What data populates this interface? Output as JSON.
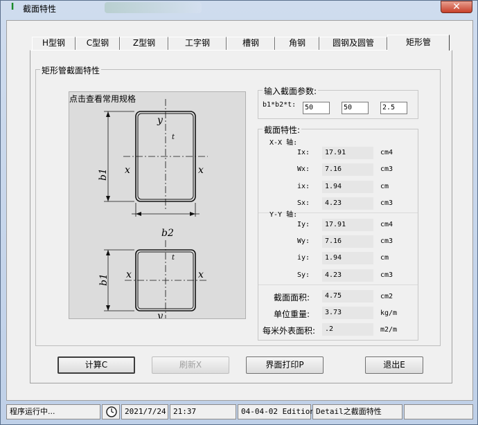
{
  "window": {
    "title": "截面特性",
    "close_glyph": "✕"
  },
  "tabs": [
    {
      "label": "H型钢"
    },
    {
      "label": "C型钢"
    },
    {
      "label": "Z型钢"
    },
    {
      "label": "工字钢"
    },
    {
      "label": "槽钢"
    },
    {
      "label": "角钢"
    },
    {
      "label": "圆钢及圆管"
    },
    {
      "label": "矩形管"
    }
  ],
  "section_group": {
    "title": "矩形管截面特性",
    "diagram_caption": "点击查看常用规格"
  },
  "diagram_labels": {
    "y": "y",
    "x": "x",
    "b1": "b1",
    "b2": "b2",
    "t": "t"
  },
  "input_group": {
    "title": "输入截面参数:",
    "param_label": "b1*b2*t:",
    "b1": "50",
    "b2": "50",
    "t": "2.5"
  },
  "props_group": {
    "title": "截面特性:",
    "xx_header": "X-X 轴:",
    "yy_header": "Y-Y 轴:",
    "xx": [
      {
        "label": "Ix:",
        "value": "17.91",
        "unit": "cm4"
      },
      {
        "label": "Wx:",
        "value": "7.16",
        "unit": "cm3"
      },
      {
        "label": "ix:",
        "value": "1.94",
        "unit": "cm"
      },
      {
        "label": "Sx:",
        "value": "4.23",
        "unit": "cm3"
      }
    ],
    "yy": [
      {
        "label": "Iy:",
        "value": "17.91",
        "unit": "cm4"
      },
      {
        "label": "Wy:",
        "value": "7.16",
        "unit": "cm3"
      },
      {
        "label": "iy:",
        "value": "1.94",
        "unit": "cm"
      },
      {
        "label": "Sy:",
        "value": "4.23",
        "unit": "cm3"
      }
    ],
    "other": [
      {
        "label": "截面面积:",
        "value": "4.75",
        "unit": "cm2"
      },
      {
        "label": "单位重量:",
        "value": "3.73",
        "unit": "kg/m"
      },
      {
        "label": "每米外表面积:",
        "value": ".2",
        "unit": "m2/m"
      }
    ]
  },
  "buttons": {
    "calc": "计算C",
    "refresh": "刷新X",
    "print": "界面打印P",
    "exit": "退出E"
  },
  "statusbar": {
    "status": "程序运行中...",
    "clock_icon": "clock-icon",
    "date": "2021/7/24",
    "time": "21:37",
    "edition": "04-04-02 Edition",
    "detail": "Detail之截面特性"
  }
}
